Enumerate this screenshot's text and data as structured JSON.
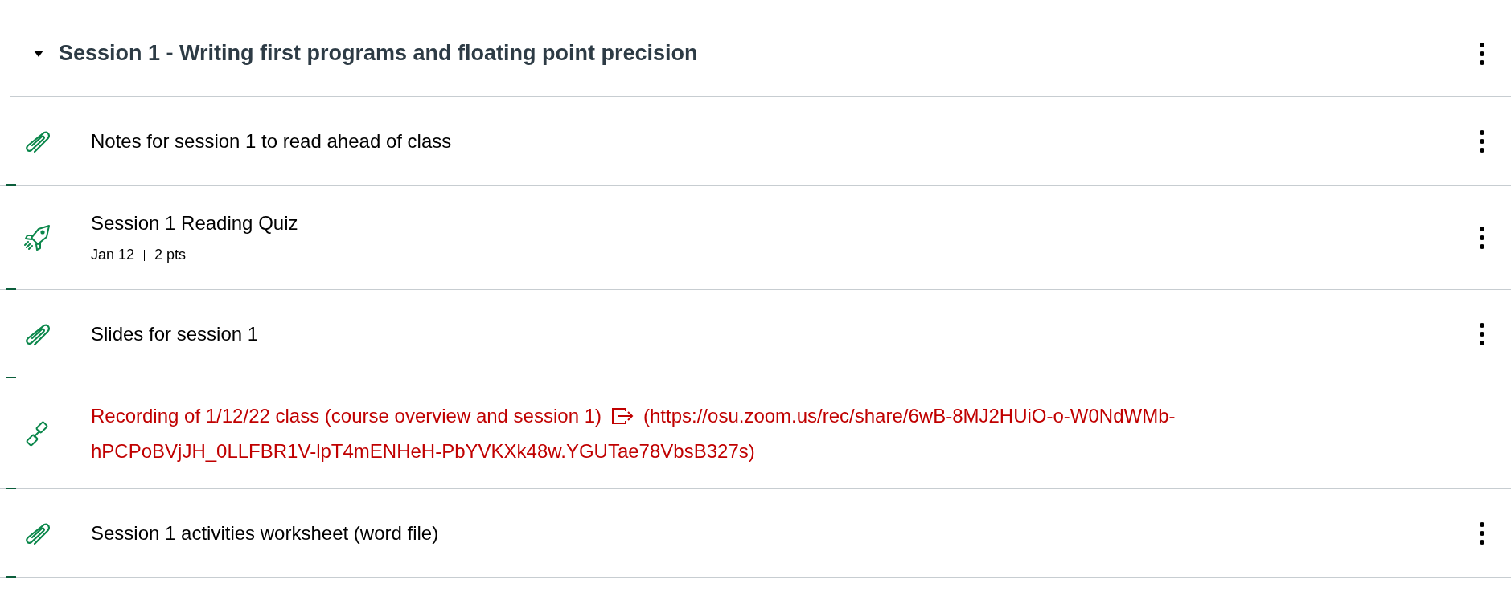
{
  "module": {
    "title": "Session 1 - Writing first programs and floating point precision",
    "expanded": true,
    "menu": true
  },
  "items": [
    {
      "kind": "attachment",
      "title": "Notes for session 1 to read ahead of class",
      "menu": true
    },
    {
      "kind": "quiz",
      "title": "Session 1 Reading Quiz",
      "due": "Jan 12",
      "points": "2 pts",
      "menu": true
    },
    {
      "kind": "attachment",
      "title": "Slides for session 1",
      "menu": true
    },
    {
      "kind": "link",
      "title": "Recording of 1/12/22 class (course overview and session 1)",
      "url_lines": [
        "(https://osu.zoom.us/rec/share/6wB-8MJ2HUiO-o-W0NdWMb-",
        "hPCPoBVjJH_0LLFBR1V-lpT4mENHeH-PbYVKXk48w.YGUTae78VbsB327s)"
      ],
      "menu": false
    },
    {
      "kind": "attachment",
      "title": "Session 1 activities worksheet (word file)",
      "menu": true
    }
  ]
}
